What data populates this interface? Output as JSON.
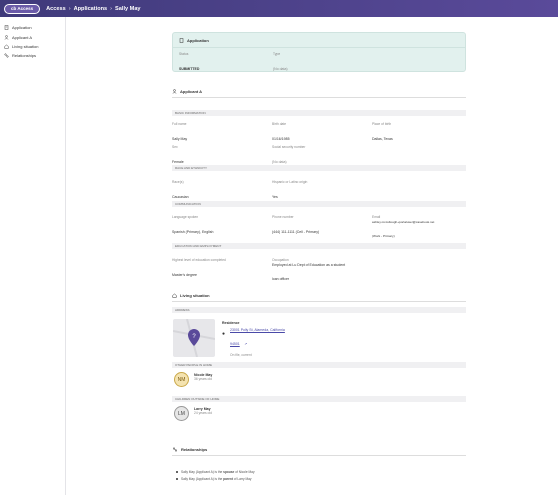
{
  "header": {
    "logo_text": "cb Access",
    "crumbs": [
      "Access",
      "Applications",
      "Sally May"
    ]
  },
  "sidebar": {
    "items": [
      {
        "label": "Application",
        "icon": "document-icon"
      },
      {
        "label": "Applicant A",
        "icon": "person-icon"
      },
      {
        "label": "Living situation",
        "icon": "home-icon"
      },
      {
        "label": "Relationships",
        "icon": "relationships-icon"
      }
    ]
  },
  "application": {
    "title": "Application",
    "status_label": "Status",
    "status_value": "SUBMITTED",
    "type_label": "Type",
    "type_value": "(No data)"
  },
  "applicant": {
    "title": "Applicant A",
    "basic": {
      "band": "BASIC INFORMATION",
      "full_name_label": "Full name",
      "full_name": "Sally May",
      "birth_label": "Birth date",
      "birth": "01/16/1985",
      "place_label": "Place of birth",
      "place": "Dallas, Texas",
      "sex_label": "Sex",
      "sex": "Female",
      "ssn_label": "Social security number",
      "ssn": "(No data)"
    },
    "race": {
      "band": "RACE AND ETHNICITY",
      "races_label": "Race(s)",
      "races": "Caucasian",
      "hisp_label": "Hispanic or Latino origin",
      "hisp": "Yes"
    },
    "comm": {
      "band": "COMMUNICATION",
      "lang_label": "Language spoken",
      "lang": "Spanish (Primary), English",
      "phone_label": "Phone number",
      "phone": "(444) 111-1111 (Cell - Primary)",
      "email_label": "Email",
      "email": "ashley.mccullough+portaluser@casebook.net",
      "email_note": "(Work - Primary)"
    },
    "edu": {
      "band": "EDUCATION AND EMPLOYMENT",
      "level_label": "Highest level of education completed",
      "level": "Master's degree",
      "occ_label": "Occupation",
      "occ_line1": "Employed at Lu Dept of Education as a student",
      "occ_line2": "loan officer"
    }
  },
  "living": {
    "title": "Living situation",
    "address_band": "ADDRESS",
    "residence_title": "Residence",
    "addr_line1": "23001 Polly St, Alameda, California",
    "addr_line2": "94501",
    "addr_note": "On file, current",
    "others_band": "OTHER PEOPLE IN HOME",
    "other_initials": "NM",
    "other_name": "Nicole May",
    "other_age": "36 years old",
    "children_band": "CHILDREN OUTSIDE OF HOME",
    "child_initials": "LM",
    "child_name": "Larry May",
    "child_age": "24 years old"
  },
  "relationships": {
    "title": "Relationships",
    "items": [
      {
        "pre": "Sally May (Applicant A) is the ",
        "rel": "spouse",
        "post": " of Nicole May"
      },
      {
        "pre": "Sally May (Applicant A) is the ",
        "rel": "parent",
        "post": " of Larry May"
      }
    ]
  }
}
